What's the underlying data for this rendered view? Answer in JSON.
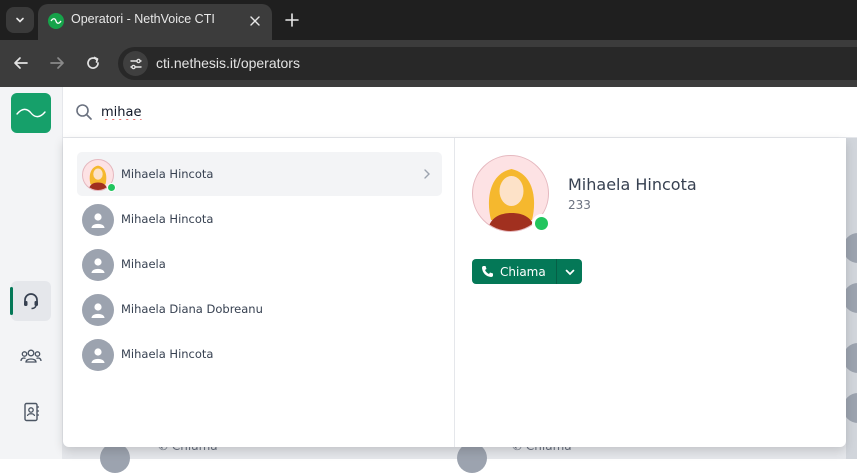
{
  "browser": {
    "tab_title": "Operatori - NethVoice CTI",
    "url": "cti.nethesis.it/operators"
  },
  "search": {
    "value": "mihae"
  },
  "results": [
    {
      "name": "Mihaela Hincota",
      "avatar": "photo",
      "online": true,
      "selected": true
    },
    {
      "name": "Mihaela Hincota",
      "avatar": "placeholder",
      "online": false,
      "selected": false
    },
    {
      "name": "Mihaela",
      "avatar": "placeholder",
      "online": false,
      "selected": false
    },
    {
      "name": "Mihaela Diana Dobreanu",
      "avatar": "placeholder",
      "online": false,
      "selected": false
    },
    {
      "name": "Mihaela Hincota",
      "avatar": "placeholder",
      "online": false,
      "selected": false
    }
  ],
  "detail": {
    "name": "Mihaela Hincota",
    "extension": "233",
    "status": "online",
    "call_label": "Chiama"
  },
  "background": {
    "call_label_1": "Chiama",
    "call_label_2": "Chiama"
  },
  "colors": {
    "brand": "#16a06a",
    "primary": "#047857",
    "online": "#22c55e"
  }
}
